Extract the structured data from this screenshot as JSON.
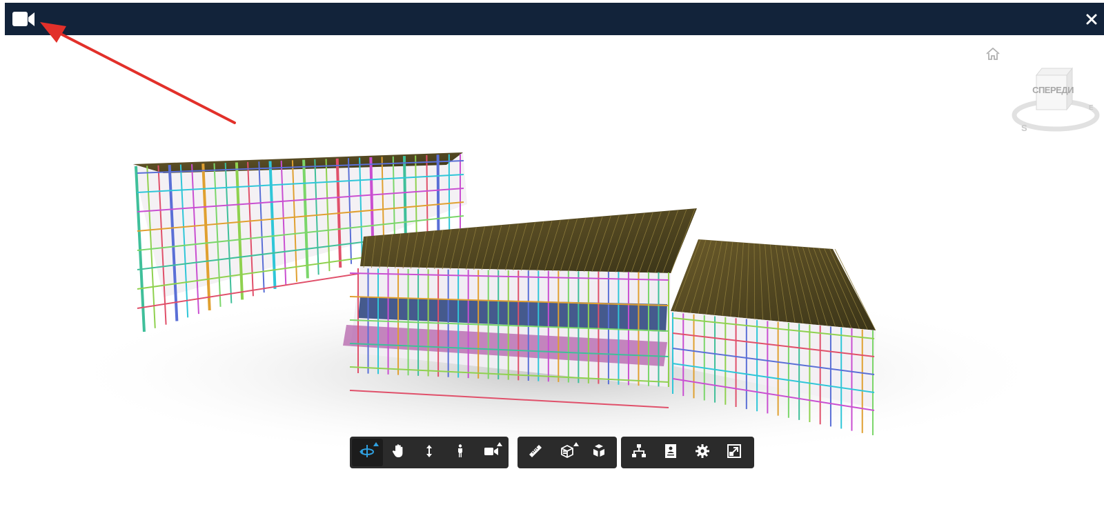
{
  "header": {
    "camera_icon": "video-camera-icon",
    "close_icon": "close-icon",
    "background_color": "#12233a"
  },
  "viewcube": {
    "face_label": "СПЕРЕДИ",
    "compass_south": "S",
    "compass_east": "E"
  },
  "home_icon": "home-icon",
  "toolbar": {
    "navigation": [
      {
        "icon": "orbit-icon",
        "active": true,
        "has_submenu": true
      },
      {
        "icon": "pan-hand-icon",
        "active": false,
        "has_submenu": false
      },
      {
        "icon": "zoom-arrows-icon",
        "active": false,
        "has_submenu": false
      },
      {
        "icon": "first-person-icon",
        "active": false,
        "has_submenu": false
      },
      {
        "icon": "camera-icon",
        "active": false,
        "has_submenu": true
      }
    ],
    "modeling": [
      {
        "icon": "measure-ruler-icon",
        "has_submenu": false
      },
      {
        "icon": "section-box-icon",
        "has_submenu": true
      },
      {
        "icon": "explode-model-icon",
        "has_submenu": false
      }
    ],
    "settings": [
      {
        "icon": "model-browser-icon"
      },
      {
        "icon": "properties-icon"
      },
      {
        "icon": "settings-gear-icon"
      },
      {
        "icon": "fullscreen-icon"
      }
    ],
    "accent_color": "#2fa0e0"
  },
  "annotation": {
    "arrow_color": "#e2302a"
  }
}
